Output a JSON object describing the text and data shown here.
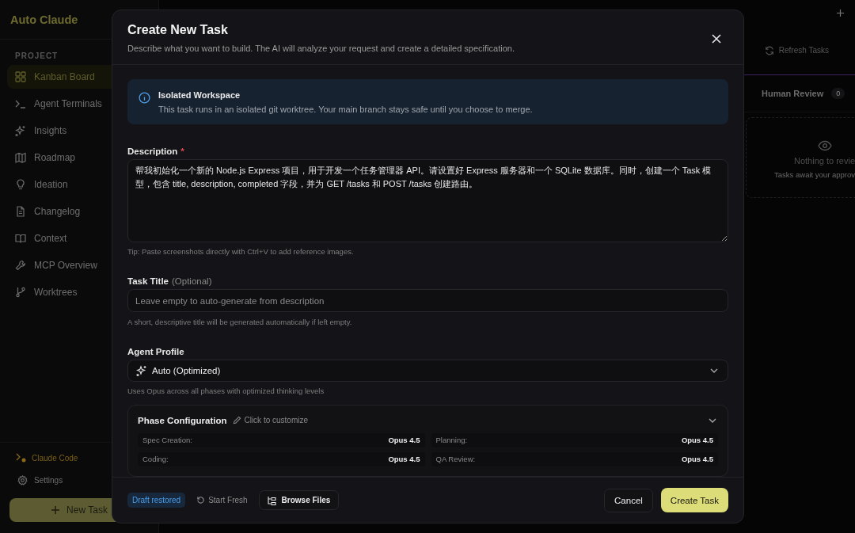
{
  "sidebar": {
    "app_title": "Auto Claude",
    "section_label": "PROJECT",
    "items": [
      {
        "label": "Kanban Board",
        "selected": true
      },
      {
        "label": "Agent Terminals",
        "selected": false
      },
      {
        "label": "Insights",
        "selected": false
      },
      {
        "label": "Roadmap",
        "selected": false
      },
      {
        "label": "Ideation",
        "selected": false
      },
      {
        "label": "Changelog",
        "selected": false
      },
      {
        "label": "Context",
        "selected": false
      },
      {
        "label": "MCP Overview",
        "selected": false
      },
      {
        "label": "Worktrees",
        "selected": false
      }
    ],
    "bottom_items": [
      {
        "label": "Claude Code",
        "kind": "status"
      },
      {
        "label": "Settings",
        "kind": "settings"
      }
    ],
    "new_task_button": "New Task"
  },
  "board": {
    "refresh_button": "Refresh Tasks",
    "column": {
      "title": "Human Review",
      "count": "0"
    },
    "empty_state": {
      "title": "Nothing to revie",
      "subtitle": "Tasks await your approv"
    }
  },
  "dialog": {
    "title": "Create New Task",
    "subtitle": "Describe what you want to build. The AI will analyze your request and create a detailed specification.",
    "info": {
      "title": "Isolated Workspace",
      "text": "This task runs in an isolated git worktree. Your main branch stays safe until you choose to merge."
    },
    "description": {
      "label": "Description",
      "required_mark": "*",
      "value": "帮我初始化一个新的 Node.js Express 项目，用于开发一个任务管理器 API。请设置好 Express 服务器和一个 SQLite 数据库。同时，创建一个 Task 模型，包含 title, description, completed 字段，并为 GET /tasks 和 POST /tasks 创建路由。",
      "tip": "Tip: Paste screenshots directly with Ctrl+V to add reference images."
    },
    "task_title": {
      "label": "Task Title",
      "optional_note": "(Optional)",
      "placeholder": "Leave empty to auto-generate from description",
      "hint": "A short, descriptive title will be generated automatically if left empty."
    },
    "agent_profile": {
      "label": "Agent Profile",
      "value": "Auto (Optimized)",
      "hint": "Uses Opus across all phases with optimized thinking levels"
    },
    "phase_config": {
      "title": "Phase Configuration",
      "edit_hint": "Click to customize",
      "phases": [
        {
          "name": "Spec Creation:",
          "model": "Opus 4.5"
        },
        {
          "name": "Planning:",
          "model": "Opus 4.5"
        },
        {
          "name": "Coding:",
          "model": "Opus 4.5"
        },
        {
          "name": "QA Review:",
          "model": "Opus 4.5"
        }
      ]
    },
    "footer": {
      "draft_badge": "Draft restored",
      "start_fresh": "Start Fresh",
      "browse_files": "Browse Files",
      "cancel": "Cancel",
      "create": "Create Task"
    }
  }
}
